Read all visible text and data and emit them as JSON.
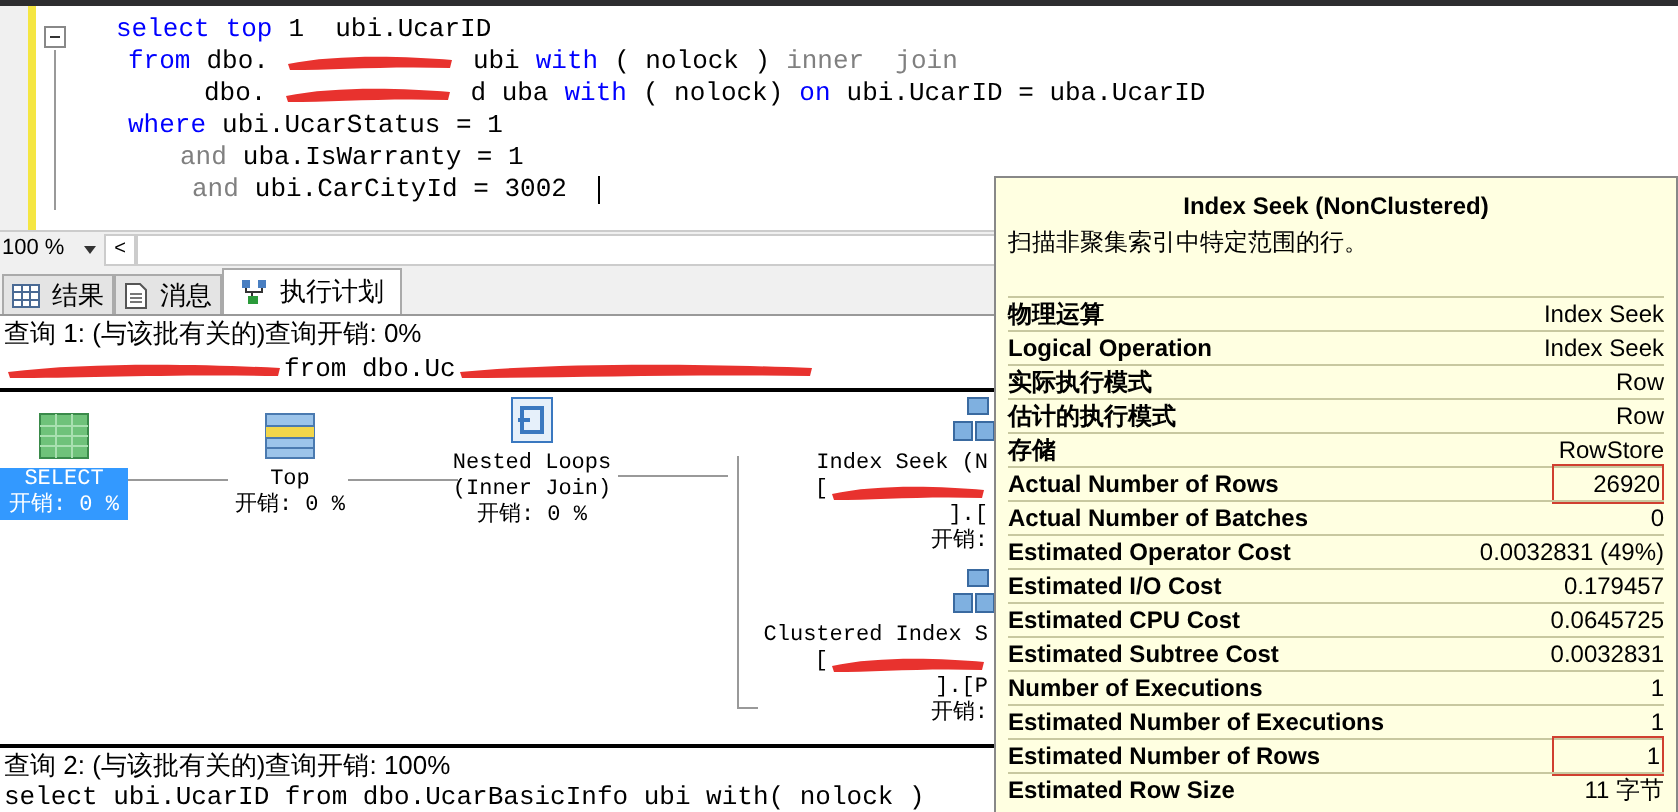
{
  "editor": {
    "lines": [
      [
        {
          "kind": "keyword",
          "text": "select"
        },
        {
          "kind": "keyword",
          "text": "top"
        },
        {
          "kind": "plain",
          "text": "1  ubi.UcarID"
        }
      ],
      [
        {
          "kind": "keyword",
          "text": "from"
        },
        {
          "kind": "plain",
          "text": "dbo."
        },
        {
          "kind": "redacted"
        },
        {
          "kind": "plain",
          "text": "ubi"
        },
        {
          "kind": "keyword",
          "text": "with"
        },
        {
          "kind": "plain",
          "text": "( nolock )"
        },
        {
          "kind": "operator",
          "text": "inner  join"
        }
      ],
      [
        {
          "kind": "plain",
          "text": "dbo."
        },
        {
          "kind": "redacted"
        },
        {
          "kind": "plain",
          "text": "d uba"
        },
        {
          "kind": "keyword",
          "text": "with"
        },
        {
          "kind": "plain",
          "text": "( nolock)"
        },
        {
          "kind": "keyword",
          "text": "on"
        },
        {
          "kind": "plain",
          "text": "ubi.UcarID = uba.UcarID"
        }
      ],
      [
        {
          "kind": "keyword",
          "text": "where"
        },
        {
          "kind": "plain",
          "text": "ubi.UcarStatus = 1"
        }
      ],
      [
        {
          "kind": "operator",
          "text": "and"
        },
        {
          "kind": "plain",
          "text": "uba.IsWarranty = 1"
        }
      ],
      [
        {
          "kind": "operator",
          "text": "and"
        },
        {
          "kind": "plain",
          "text": "ubi.CarCityId = 3002"
        },
        {
          "kind": "caret"
        }
      ]
    ],
    "zoom": "100 %",
    "scroll_arrow": "<"
  },
  "tabs": [
    {
      "label": "结果",
      "selected": false
    },
    {
      "label": "消息",
      "selected": false
    },
    {
      "label": "执行计划",
      "selected": true
    }
  ],
  "queries": [
    {
      "header": "查询 1: (与该批有关的)查询开销: 0%",
      "sql": "from dbo.Uc",
      "redacted": true
    },
    {
      "header": "查询 2: (与该批有关的)查询开销: 100%",
      "sql": "select ubi.UcarID from dbo.UcarBasicInfo ubi with( nolock )",
      "redacted": false
    }
  ],
  "plan_nodes": [
    {
      "kind": "select",
      "lines": [
        "SELECT",
        "开销: 0 %"
      ],
      "selected": true
    },
    {
      "kind": "top",
      "lines": [
        "Top",
        "开销: 0 %"
      ],
      "selected": false
    },
    {
      "kind": "loops",
      "lines": [
        "Nested Loops",
        "(Inner Join)",
        "开销: 0 %"
      ],
      "selected": false
    },
    {
      "kind": "seek",
      "lines": [
        "Index Seek (N",
        "[",
        "].[",
        "开销:"
      ],
      "selected": false
    },
    {
      "kind": "clustered",
      "lines": [
        "Clustered Index S",
        "[",
        "].[P",
        "开销:"
      ],
      "selected": false
    }
  ],
  "tooltip": {
    "title": "Index Seek (NonClustered)",
    "description": "扫描非聚集索引中特定范围的行。",
    "rows": [
      {
        "label": "物理运算",
        "value": "Index Seek",
        "highlighted": false
      },
      {
        "label": "Logical Operation",
        "value": "Index Seek",
        "highlighted": false
      },
      {
        "label": "实际执行模式",
        "value": "Row",
        "highlighted": false
      },
      {
        "label": "估计的执行模式",
        "value": "Row",
        "highlighted": false
      },
      {
        "label": "存储",
        "value": "RowStore",
        "highlighted": false
      },
      {
        "label": "Actual Number of Rows",
        "value": "26920",
        "highlighted": true
      },
      {
        "label": "Actual Number of Batches",
        "value": "0",
        "highlighted": false
      },
      {
        "label": "Estimated Operator Cost",
        "value": "0.0032831 (49%)",
        "highlighted": false
      },
      {
        "label": "Estimated I/O Cost",
        "value": "0.179457",
        "highlighted": false
      },
      {
        "label": "Estimated CPU Cost",
        "value": "0.0645725",
        "highlighted": false
      },
      {
        "label": "Estimated Subtree Cost",
        "value": "0.0032831",
        "highlighted": false
      },
      {
        "label": "Number of Executions",
        "value": "1",
        "highlighted": false
      },
      {
        "label": "Estimated Number of Executions",
        "value": "1",
        "highlighted": false
      },
      {
        "label": "Estimated Number of Rows",
        "value": "1",
        "highlighted": true
      },
      {
        "label": "Estimated Row Size",
        "value": "11 字节",
        "highlighted": false
      }
    ]
  }
}
